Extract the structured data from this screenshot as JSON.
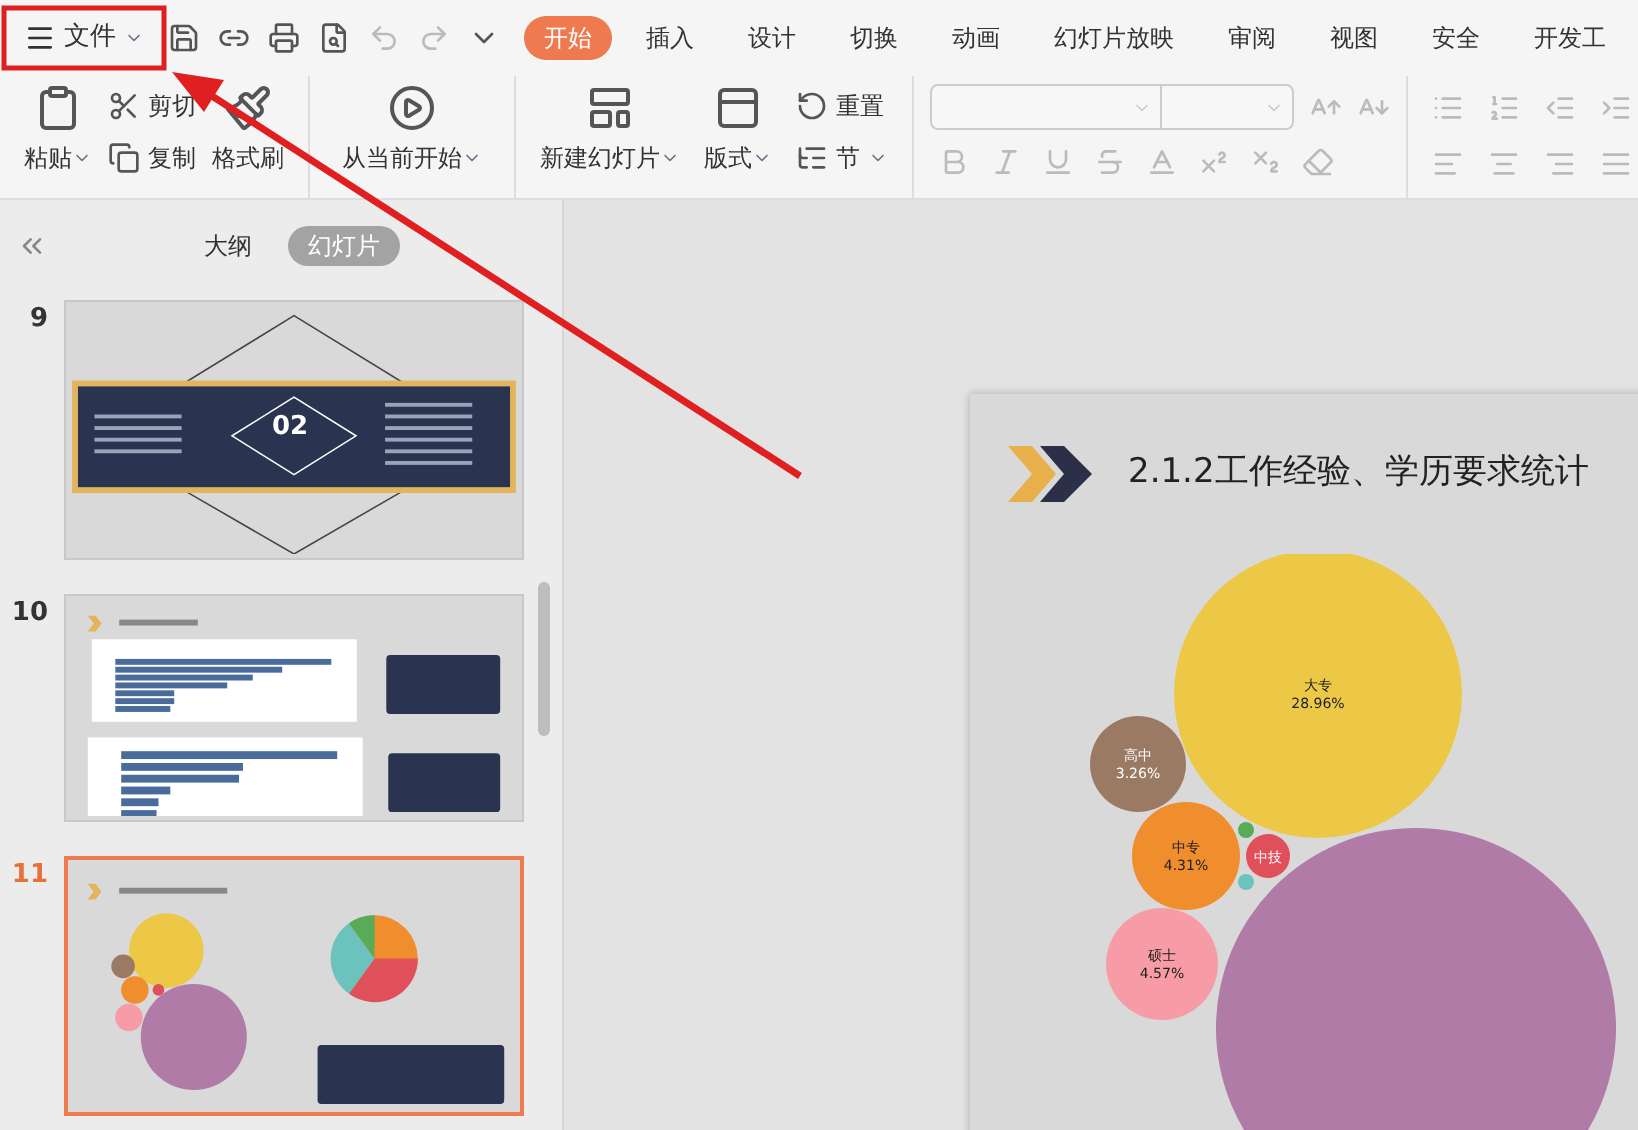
{
  "menu_button": {
    "label": "文件"
  },
  "tabs": [
    {
      "label": "开始",
      "selected": true
    },
    {
      "label": "插入",
      "selected": false
    },
    {
      "label": "设计",
      "selected": false
    },
    {
      "label": "切换",
      "selected": false
    },
    {
      "label": "动画",
      "selected": false
    },
    {
      "label": "幻灯片放映",
      "selected": false
    },
    {
      "label": "审阅",
      "selected": false
    },
    {
      "label": "视图",
      "selected": false
    },
    {
      "label": "安全",
      "selected": false
    },
    {
      "label": "开发工",
      "selected": false
    }
  ],
  "ribbon": {
    "paste": "粘贴",
    "cut": "剪切",
    "copy": "复制",
    "format_painter": "格式刷",
    "play_from_current": "从当前开始",
    "new_slide": "新建幻灯片",
    "layout": "版式",
    "reset": "重置",
    "section": "节"
  },
  "panel_tabs": [
    {
      "label": "大纲",
      "selected": false
    },
    {
      "label": "幻灯片",
      "selected": true
    }
  ],
  "thumbnails": [
    {
      "number": "9",
      "kind": "section",
      "selected": false,
      "big_number": "02"
    },
    {
      "number": "10",
      "kind": "bars",
      "selected": false
    },
    {
      "number": "11",
      "kind": "bubbles",
      "selected": true
    }
  ],
  "slide": {
    "title": "2.1.2工作经验、学历要求统计",
    "bubbles": [
      {
        "label": "大专",
        "value": "28.96%",
        "color": "#ecc846"
      },
      {
        "label": "高中",
        "value": "3.26%",
        "color": "#9a7a63"
      },
      {
        "label": "中专",
        "value": "4.31%",
        "color": "#f08d2c"
      },
      {
        "label": "中技",
        "color": "#e0505a"
      },
      {
        "color": "#5aab57"
      },
      {
        "color": "#6cc3bd"
      },
      {
        "label": "硕士",
        "value": "4.57%",
        "color": "#f79ca6"
      },
      {
        "color": "#b07ba6"
      }
    ]
  }
}
